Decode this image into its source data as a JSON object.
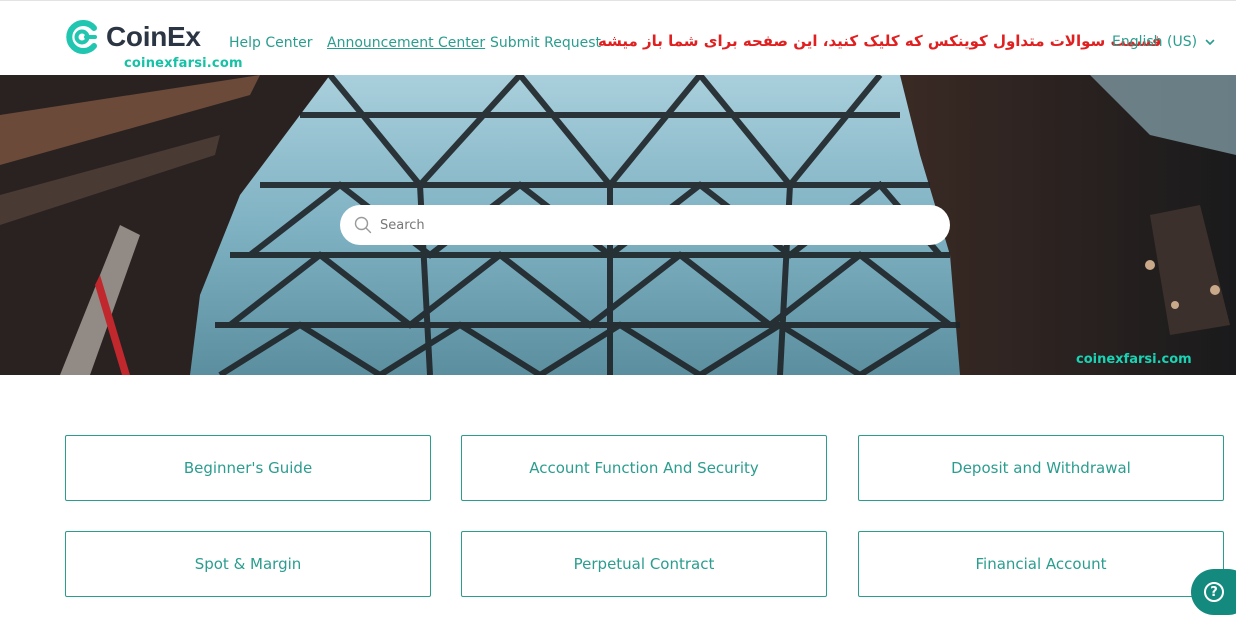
{
  "header": {
    "logo_text": "CoinEx",
    "watermark": "coinexfarsi.com",
    "nav": {
      "help_center": "Help Center",
      "announcement_center": "Announcement Center",
      "submit_request": "Submit Request"
    },
    "persian_note": "قسمت سوالات متداول کوینکس که کلیک کنید، این صفحه برای شما باز میشه",
    "language": "English (US)"
  },
  "hero": {
    "search_placeholder": "Search",
    "watermark": "coinexfarsi.com"
  },
  "categories": [
    {
      "label": "Beginner's Guide"
    },
    {
      "label": "Account Function And Security"
    },
    {
      "label": "Deposit and Withdrawal"
    },
    {
      "label": "Spot & Margin"
    },
    {
      "label": "Perpetual Contract"
    },
    {
      "label": "Financial Account"
    }
  ],
  "colors": {
    "accent": "#2a9d8f",
    "watermark": "#16c1a5",
    "note_red": "#e02020",
    "fab": "#14897d"
  },
  "icons": {
    "logo": "coinex-logo-icon",
    "search": "search-icon",
    "chevron": "chevron-down-icon",
    "help": "help-question-icon"
  }
}
